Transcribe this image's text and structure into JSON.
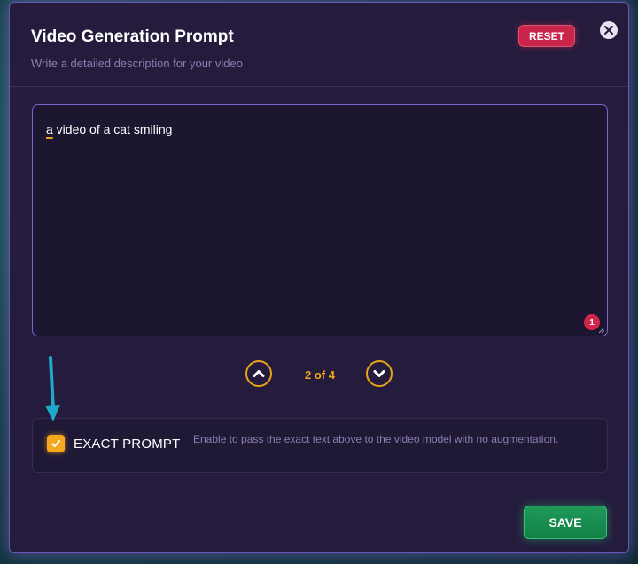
{
  "dialog": {
    "title": "Video Generation Prompt",
    "subtitle": "Write a detailed description for your video",
    "reset_label": "RESET",
    "close_icon": "close-icon"
  },
  "prompt": {
    "first_word": "a",
    "rest": " video of a cat smiling",
    "badge_count": "1"
  },
  "pager": {
    "indicator": "2 of 4",
    "prev_icon": "chevron-up-icon",
    "next_icon": "chevron-down-icon"
  },
  "exact_prompt": {
    "checked": true,
    "label": "EXACT PROMPT",
    "description": "Enable to pass the exact text above to the video model with no augmentation."
  },
  "footer": {
    "save_label": "SAVE"
  },
  "colors": {
    "accent": "#e8a21a",
    "danger": "#c9254a",
    "success": "#1e9a5a",
    "panel": "#251c3d",
    "annotation_arrow": "#1ea9c9"
  }
}
